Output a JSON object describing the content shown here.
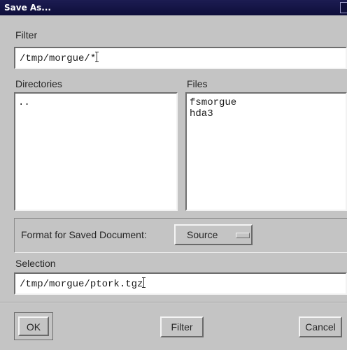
{
  "window": {
    "title": "Save As..."
  },
  "filter": {
    "label": "Filter",
    "value": "/tmp/morgue/*"
  },
  "directories": {
    "label": "Directories",
    "items": [
      ".."
    ]
  },
  "files": {
    "label": "Files",
    "items": [
      "fsmorgue",
      "hda3"
    ]
  },
  "format": {
    "label": "Format for Saved Document:",
    "selected": "Source"
  },
  "selection": {
    "label": "Selection",
    "value": "/tmp/morgue/ptork.tgz"
  },
  "buttons": {
    "ok": "OK",
    "filter": "Filter",
    "cancel": "Cancel"
  }
}
